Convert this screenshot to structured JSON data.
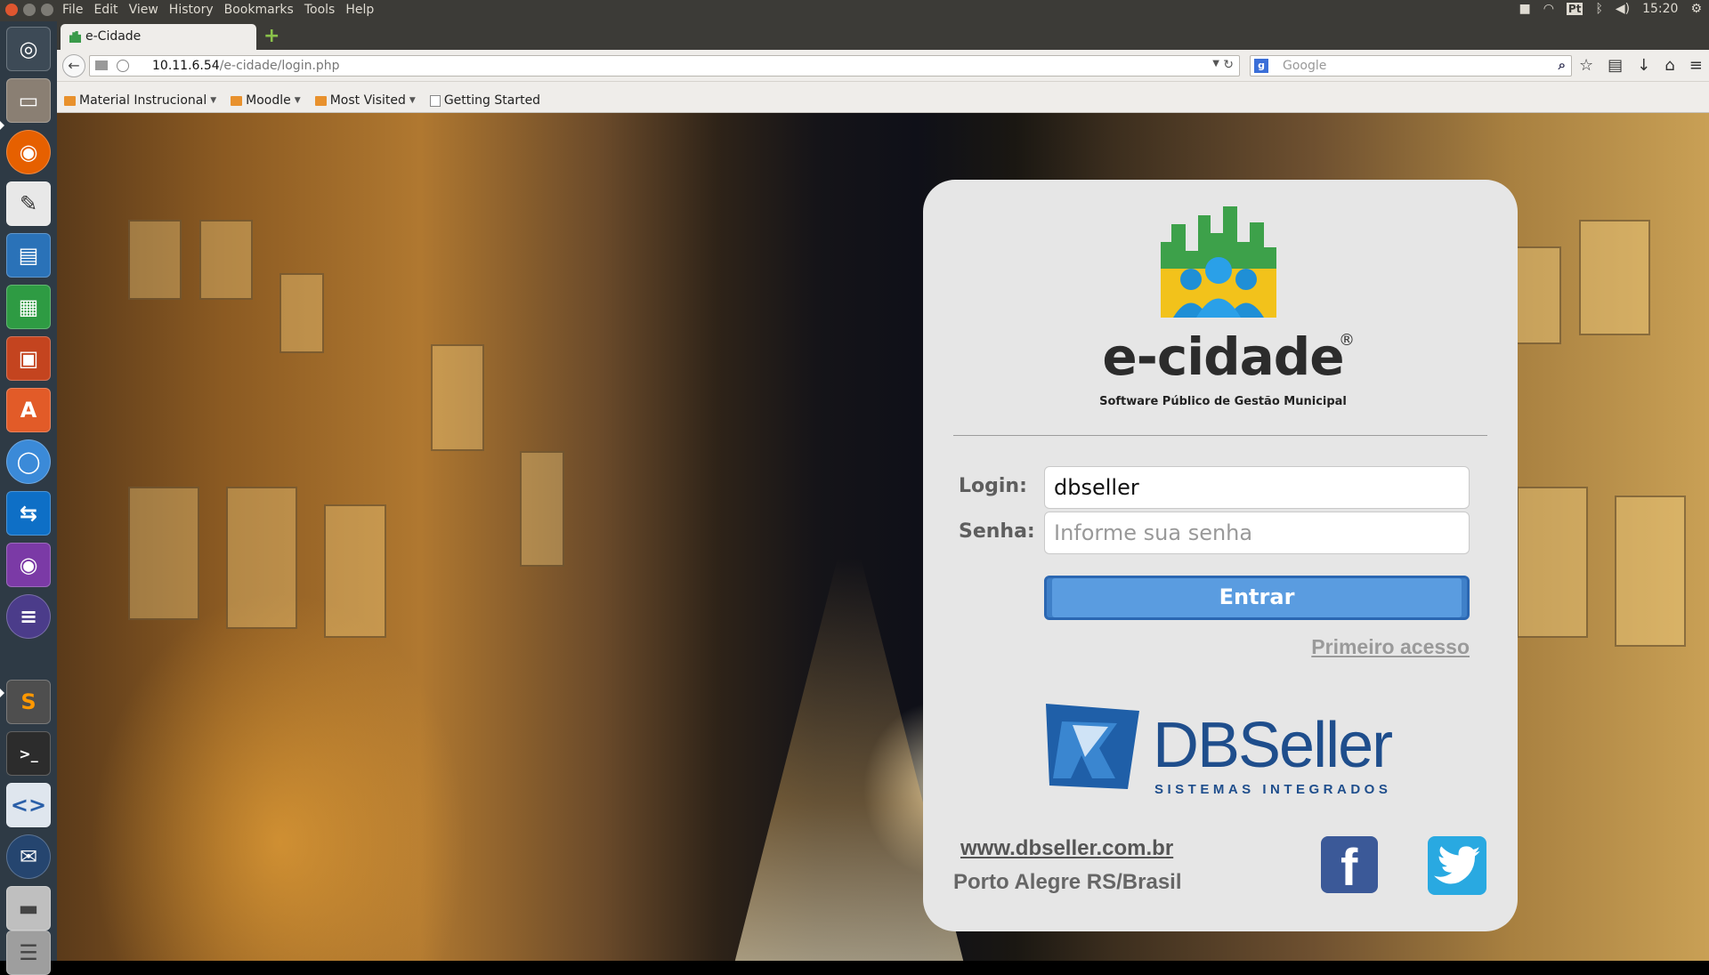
{
  "menubar": {
    "items": [
      "File",
      "Edit",
      "View",
      "History",
      "Bookmarks",
      "Tools",
      "Help"
    ],
    "tray": {
      "keyboard": "Pt",
      "time": "15:20"
    }
  },
  "browser": {
    "tab_title": "e-Cidade",
    "url_host": "10.11.6.54",
    "url_path": "/e-cidade/login.php",
    "search_placeholder": "Google",
    "bookmarks": [
      {
        "label": "Material Instrucional",
        "type": "folder"
      },
      {
        "label": "Moodle",
        "type": "folder"
      },
      {
        "label": "Most Visited",
        "type": "folder"
      },
      {
        "label": "Getting Started",
        "type": "page"
      }
    ]
  },
  "launcher": {
    "icons": [
      "ubuntu-dash",
      "files",
      "firefox",
      "text-editor",
      "writer",
      "calc",
      "impress",
      "software-center",
      "chromium",
      "teamviewer",
      "webcam",
      "eclipse",
      "sublime-text",
      "terminal",
      "code-editor",
      "thunderbird",
      "disk",
      "trash"
    ]
  },
  "login": {
    "brand": "e-cidade",
    "brand_mark": "®",
    "tagline": "Software Público de Gestão Municipal",
    "login_label": "Login:",
    "login_value": "dbseller",
    "password_label": "Senha:",
    "password_placeholder": "Informe sua senha",
    "submit_label": "Entrar",
    "first_access_label": "Primeiro acesso",
    "company_name": "DBSeller",
    "company_subtitle": "SISTEMAS INTEGRADOS",
    "website": "www.dbseller.com.br",
    "location": "Porto Alegre RS/Brasil"
  },
  "colors": {
    "menubar_bg": "#3c3b37",
    "launcher_bg": "#2e3a45",
    "card_bg": "#e6e6e6",
    "button_bg": "#5a9ce0",
    "button_border": "#2b67b2",
    "brand_blue": "#1f4e8c",
    "facebook": "#3b5998",
    "twitter": "#29a9e1"
  }
}
